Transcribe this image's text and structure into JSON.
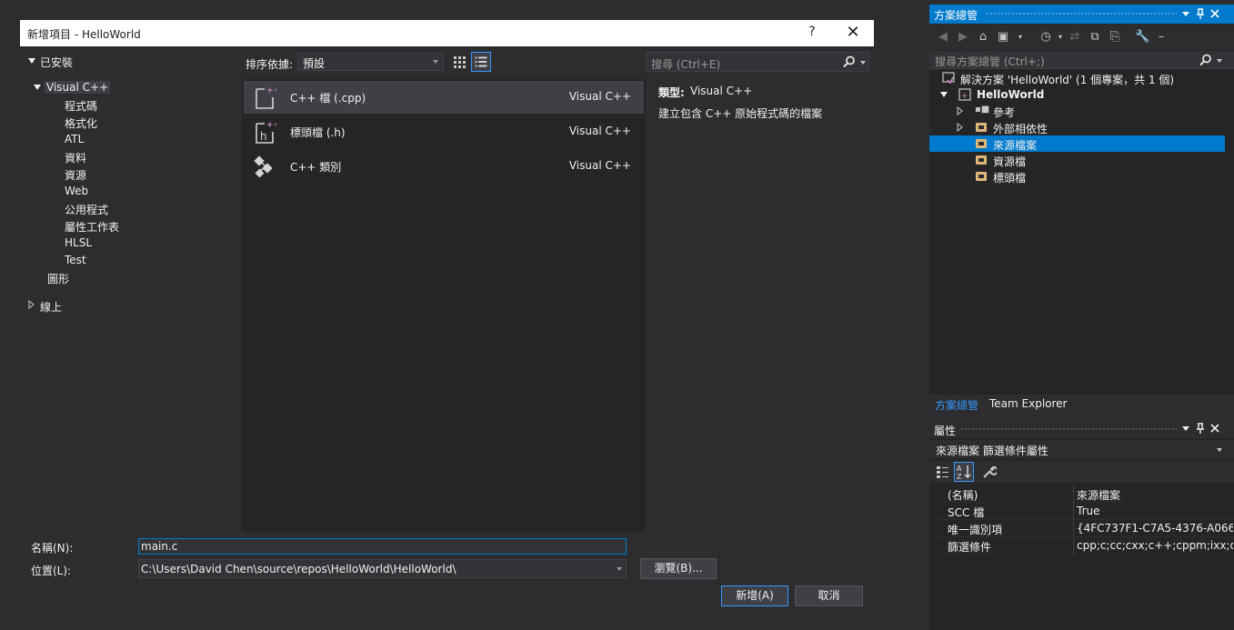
{
  "dialog": {
    "title": "新增項目 - HelloWorld",
    "help_glyph": "?",
    "close_glyph": "✕",
    "tree": {
      "installed": "已安裝",
      "visual_cpp": "Visual C++",
      "children": [
        "程式碼",
        "格式化",
        "ATL",
        "資料",
        "資源",
        "Web",
        "公用程式",
        "屬性工作表",
        "HLSL",
        "Test"
      ],
      "graphics": "圖形",
      "online": "線上"
    },
    "sort": {
      "label": "排序依據:",
      "value": "預設"
    },
    "search_placeholder": "搜尋 (Ctrl+E)",
    "items": [
      {
        "name": "C++ 檔 (.cpp)",
        "type": "Visual C++",
        "selected": true
      },
      {
        "name": "標頭檔 (.h)",
        "type": "Visual C++",
        "selected": false
      },
      {
        "name": "C++ 類別",
        "type": "Visual C++",
        "selected": false
      }
    ],
    "detail": {
      "type_label": "類型:",
      "type_value": "Visual C++",
      "description": "建立包含 C++ 原始程式碼的檔案"
    },
    "name_label": "名稱(N):",
    "name_value": "main.c",
    "location_label": "位置(L):",
    "location_value": "C:\\Users\\David Chen\\source\\repos\\HelloWorld\\HelloWorld\\",
    "browse_label": "瀏覽(B)...",
    "add_label": "新增(A)",
    "cancel_label": "取消"
  },
  "solution_explorer": {
    "title": "方案總管",
    "search_placeholder": "搜尋方案總管 (Ctrl+;)",
    "solution": "解決方案 'HelloWorld' (1 個專案，共 1 個)",
    "project": "HelloWorld",
    "nodes": [
      {
        "label": "參考",
        "selected": false
      },
      {
        "label": "外部相依性",
        "selected": false
      },
      {
        "label": "來源檔案",
        "selected": true
      },
      {
        "label": "資源檔",
        "selected": false
      },
      {
        "label": "標頭檔",
        "selected": false
      }
    ],
    "tabs": [
      "方案總管",
      "Team Explorer"
    ]
  },
  "properties": {
    "title": "屬性",
    "object": "來源檔案  篩選條件屬性",
    "rows": [
      {
        "name": "(名稱)",
        "value": "來源檔案"
      },
      {
        "name": "SCC 檔",
        "value": "True"
      },
      {
        "name": "唯一識別項",
        "value": "{4FC737F1-C7A5-4376-A066"
      },
      {
        "name": "篩選條件",
        "value": "cpp;c;cc;cxx;c++;cppm;ixx;de"
      }
    ]
  },
  "colors": {
    "accent": "#007acc",
    "background": "#2d2d30",
    "panel": "#252526",
    "folder": "#dcb67a",
    "cpp_badge": "#c586c0"
  }
}
